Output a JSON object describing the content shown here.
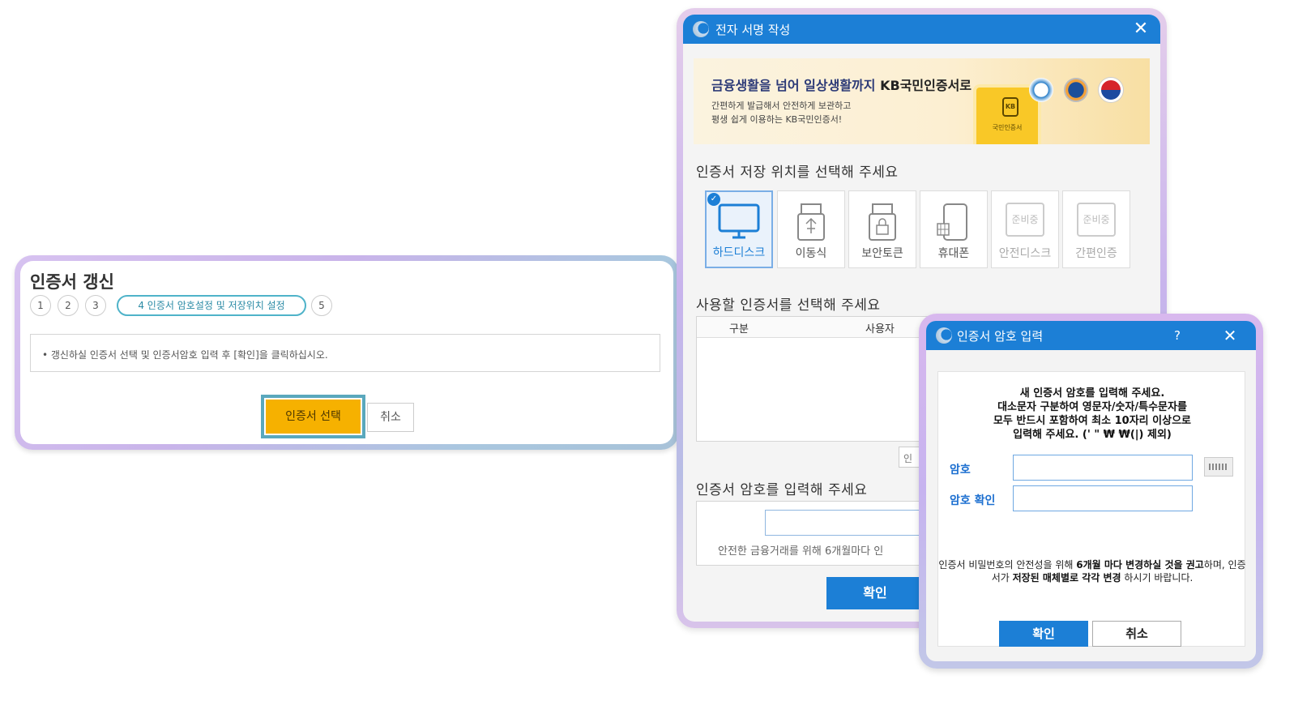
{
  "renew": {
    "title": "인증서 갱신",
    "steps": [
      "1",
      "2",
      "3",
      "5"
    ],
    "active_step": "4 인증서 암호설정 및 저장위치 설정",
    "notice": "• 갱신하실 인증서 선택 및 인증서암호 입력 후 [확인]을 클릭하십시오.",
    "select_button": "인증서 선택",
    "cancel_button": "취소",
    "highlight_color": "#5aa8bd",
    "select_button_color": "#f6b100"
  },
  "sign_dialog": {
    "title": "전자 서명 작성",
    "close_icon": "close-icon",
    "banner": {
      "headline_a": "금융생활을 넘어 일상생활까지",
      "headline_b": "KB국민인증서로",
      "sub1": "간편하게 발급해서 안전하게 보관하고",
      "sub2": "평생 쉽게 이용하는 KB국민인증서!",
      "card_label": "국민인증서",
      "card_logo": "KB"
    },
    "storage_title": "인증서 저장 위치를 선택해 주세요",
    "storage_options": [
      {
        "label": "하드디스크",
        "icon": "monitor-icon",
        "selected": true
      },
      {
        "label": "이동식",
        "icon": "usb-icon"
      },
      {
        "label": "보안토큰",
        "icon": "security-token-icon"
      },
      {
        "label": "휴대폰",
        "icon": "phone-icon"
      },
      {
        "label": "안전디스크",
        "icon": "ready-icon",
        "badge": "준비중",
        "disabled": true
      },
      {
        "label": "간편인증",
        "icon": "ready-icon",
        "badge": "준비중",
        "disabled": true
      }
    ],
    "cert_title": "사용할 인증서를 선택해 주세요",
    "table_headers": [
      "구분",
      "사용자"
    ],
    "detail_button": "인",
    "password_title": "인증서 암호를 입력해 주세요",
    "password_hint": "안전한 금융거래를 위해 6개월마다 인",
    "ok_button": "확인",
    "accent": "#1c7fd6"
  },
  "pw_dialog": {
    "title": "인증서 암호 입력",
    "help": "?",
    "close": "✕",
    "instructions": [
      "새 인증서 암호를 입력해 주세요.",
      "대소문자 구분하여 영문자/숫자/특수문자를",
      "모두 반드시 포함하여 최소 10자리 이상으로",
      "입력해 주세요. (' \" ₩ ₩(|) 제외)"
    ],
    "password_label": "암호",
    "confirm_label": "암호 확인",
    "password_value": "",
    "confirm_value": "",
    "note": {
      "p1": "인증서 비밀번호의 안전성을 위해 ",
      "b1": "6개월 마다 변경하실 것을 권고",
      "p2": "하며, 인증서가 ",
      "b2": "저장된 매체별로 각각 변경",
      "p3": " 하시기 바랍니다."
    },
    "ok_button": "확인",
    "cancel_button": "취소"
  }
}
